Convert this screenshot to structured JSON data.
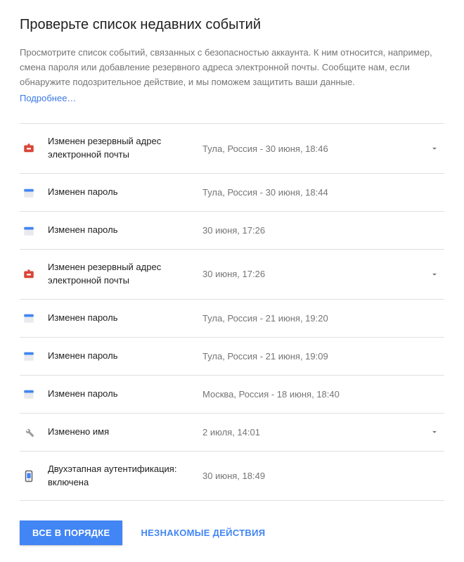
{
  "title": "Проверьте список недавних событий",
  "description": "Просмотрите список событий, связанных с безопасностью аккаунта. К ним относится, например, смена пароля или добавление резервного адреса электронной почты. Сообщите нам, если обнаружите подозрительное действие, и мы поможем защитить ваши данные.",
  "learn_more": "Подробнее…",
  "events": [
    {
      "icon": "email-red",
      "label": "Изменен резервный адрес электронной почты",
      "detail": "Тула, Россия - 30 июня, 18:46",
      "expandable": true
    },
    {
      "icon": "calendar",
      "label": "Изменен пароль",
      "detail": "Тула, Россия - 30 июня, 18:44",
      "expandable": false
    },
    {
      "icon": "calendar",
      "label": "Изменен пароль",
      "detail": "30 июня, 17:26",
      "expandable": false
    },
    {
      "icon": "email-red",
      "label": "Изменен резервный адрес электронной почты",
      "detail": "30 июня, 17:26",
      "expandable": true
    },
    {
      "icon": "calendar",
      "label": "Изменен пароль",
      "detail": "Тула, Россия - 21 июня, 19:20",
      "expandable": false
    },
    {
      "icon": "calendar",
      "label": "Изменен пароль",
      "detail": "Тула, Россия - 21 июня, 19:09",
      "expandable": false
    },
    {
      "icon": "calendar",
      "label": "Изменен пароль",
      "detail": "Москва, Россия - 18 июня, 18:40",
      "expandable": false
    },
    {
      "icon": "wrench",
      "label": "Изменено имя",
      "detail": "2 июля, 14:01",
      "expandable": true
    },
    {
      "icon": "phone",
      "label": "Двухэтапная аутентификация: включена",
      "detail": "30 июня, 18:49",
      "expandable": false
    }
  ],
  "buttons": {
    "ok": "ВСЕ В ПОРЯДКЕ",
    "unfamiliar": "НЕЗНАКОМЫЕ ДЕЙСТВИЯ"
  }
}
